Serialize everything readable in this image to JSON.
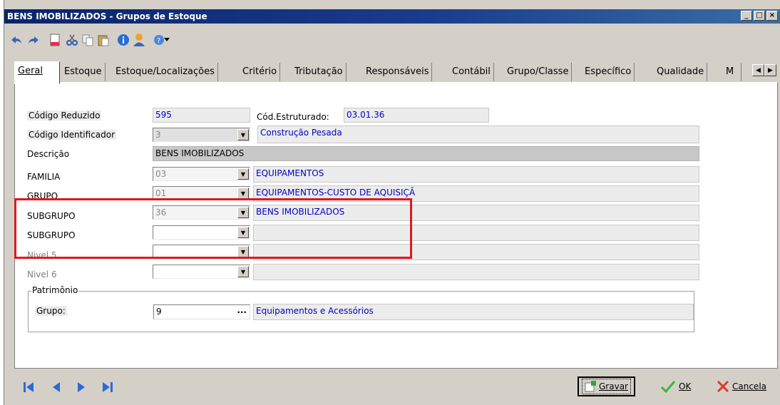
{
  "window": {
    "title": "BENS IMOBILIZADOS - Grupos de Estoque",
    "controls": [
      "_",
      "□",
      "×"
    ]
  },
  "toolbar": {
    "icons": [
      "undo-icon",
      "redo-icon",
      "new-document-icon",
      "cut-icon",
      "copy-icon",
      "paste-icon",
      "info-icon",
      "user-icon",
      "help-icon",
      "dropdown-arrow-icon"
    ]
  },
  "tabs": [
    {
      "label": "Geral",
      "active": true
    },
    {
      "label": "Estoque"
    },
    {
      "label": "Estoque/Localizações"
    },
    {
      "label": "Critério"
    },
    {
      "label": "Tributação"
    },
    {
      "label": "Responsáveis"
    },
    {
      "label": "Contábil"
    },
    {
      "label": "Grupo/Classe"
    },
    {
      "label": "Específico"
    },
    {
      "label": "Qualidade"
    },
    {
      "label": "M"
    }
  ],
  "form": {
    "codigo_reduzido": {
      "label": "Código Reduzido",
      "value": "595"
    },
    "cod_estruturado": {
      "label": "Cód.Estruturado:",
      "value": "03.01.36"
    },
    "codigo_identificador": {
      "label": "Código Identificador",
      "value": "3",
      "desc": "Construção Pesada"
    },
    "descricao": {
      "label": "Descrição",
      "value": "BENS IMOBILIZADOS"
    },
    "familia": {
      "label": "FAMILIA",
      "value": "03",
      "desc": "EQUIPAMENTOS"
    },
    "grupo": {
      "label": "GRUPO",
      "value": "01",
      "desc": "EQUIPAMENTOS-CUSTO DE AQUISIÇÃ"
    },
    "subgrupo1": {
      "label": "SUBGRUPO",
      "value": "36",
      "desc": "BENS IMOBILIZADOS"
    },
    "subgrupo2": {
      "label": "SUBGRUPO",
      "value": "",
      "desc": ""
    },
    "nivel5": {
      "label": "Nivel 5",
      "value": "",
      "desc": ""
    },
    "nivel6": {
      "label": "Nivel 6",
      "value": "",
      "desc": ""
    }
  },
  "patrimonio": {
    "legend": "Patrimônio",
    "grupo_label": "Grupo:",
    "grupo_value": "9",
    "ellipsis": "...",
    "grupo_desc": "Equipamentos e Acessórios"
  },
  "bottom": {
    "gravar": "Gravar",
    "ok": "OK",
    "cancelar": "Cancela"
  },
  "colors": {
    "title_bar": "#0a246a",
    "highlight_box": "#e0181e",
    "value_blue": "#0000c8"
  }
}
